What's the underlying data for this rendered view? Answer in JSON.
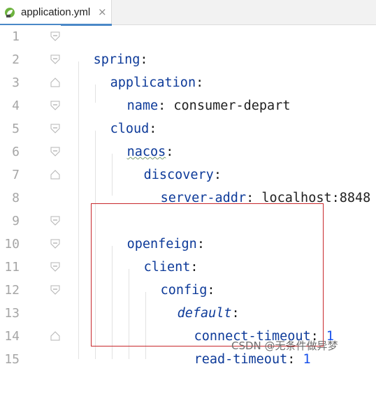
{
  "tab": {
    "label": "application.yml",
    "close_glyph": "×",
    "icon": "spring-leaf-icon"
  },
  "gutter": {
    "line_numbers": [
      "1",
      "2",
      "3",
      "4",
      "5",
      "6",
      "7",
      "8",
      "9",
      "10",
      "11",
      "12",
      "13",
      "14",
      "15"
    ]
  },
  "code": {
    "lines": [
      {
        "key": "spring",
        "colon": ":",
        "value": ""
      },
      {
        "key": "application",
        "colon": ":",
        "value": ""
      },
      {
        "key": "name",
        "colon": ":",
        "value": " consumer-depart"
      },
      {
        "key": "cloud",
        "colon": ":",
        "value": ""
      },
      {
        "key": "nacos",
        "colon": ":",
        "value": ""
      },
      {
        "key": "discovery",
        "colon": ":",
        "value": ""
      },
      {
        "key": "server-addr",
        "colon": ":",
        "value": " localhost:8848"
      },
      {
        "key": "",
        "colon": "",
        "value": ""
      },
      {
        "key": "openfeign",
        "colon": ":",
        "value": ""
      },
      {
        "key": "client",
        "colon": ":",
        "value": ""
      },
      {
        "key": "config",
        "colon": ":",
        "value": ""
      },
      {
        "key": "default",
        "colon": ":",
        "value": ""
      },
      {
        "key": "connect-timeout",
        "colon": ":",
        "value": "1"
      },
      {
        "key": "read-timeout",
        "colon": ":",
        "value": "1"
      }
    ]
  },
  "watermark": "CSDN @无条件做异梦",
  "colors": {
    "key": "#0d3a99",
    "number": "#1750eb",
    "highlight_border": "#c8282c",
    "tab_underline": "#4a88c7"
  }
}
